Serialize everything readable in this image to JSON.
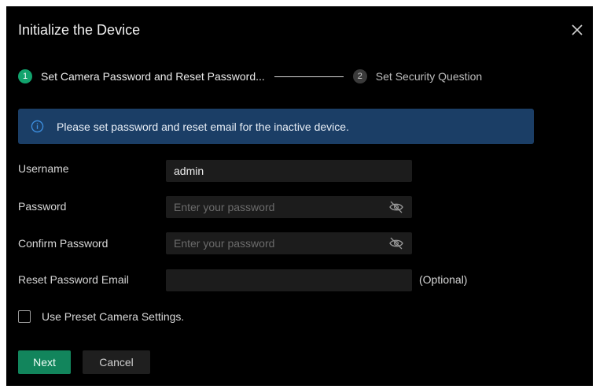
{
  "dialog": {
    "title": "Initialize the Device",
    "close_icon": "close-icon"
  },
  "steps": [
    {
      "number": "1",
      "label": "Set Camera Password and Reset Password...",
      "state": "active"
    },
    {
      "number": "2",
      "label": "Set Security Question",
      "state": "inactive"
    }
  ],
  "banner": {
    "icon": "info-icon",
    "text": "Please set password and reset email for the inactive device."
  },
  "form": {
    "username": {
      "label": "Username",
      "value": "admin"
    },
    "password": {
      "label": "Password",
      "placeholder": "Enter your password",
      "icon": "eye-hidden-icon"
    },
    "confirm_password": {
      "label": "Confirm Password",
      "placeholder": "Enter your password",
      "icon": "eye-hidden-icon"
    },
    "reset_email": {
      "label": "Reset Password Email",
      "value": "",
      "note": "(Optional)"
    }
  },
  "preset": {
    "label": "Use Preset Camera Settings.",
    "checked": false
  },
  "buttons": {
    "next": "Next",
    "cancel": "Cancel"
  },
  "colors": {
    "background": "#000000",
    "accent_green": "#12855c",
    "banner_blue": "#1b3e66",
    "field_bg": "#1c1c1c"
  }
}
